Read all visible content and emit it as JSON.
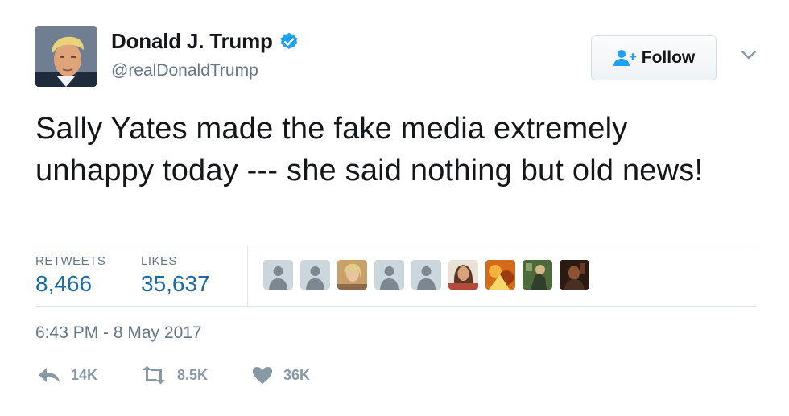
{
  "author": {
    "name": "Donald J. Trump",
    "handle": "@realDonaldTrump"
  },
  "follow_button": {
    "label": "Follow"
  },
  "tweet": {
    "text": "Sally Yates made the fake media extremely unhappy today --- she said nothing but old news!"
  },
  "stats": {
    "retweets_label": "RETWEETS",
    "retweets_value": "8,466",
    "likes_label": "LIKES",
    "likes_value": "35,637"
  },
  "timestamp": "6:43 PM - 8 May 2017",
  "actions": {
    "reply_count": "14K",
    "retweet_count": "8.5K",
    "like_count": "36K"
  },
  "colors": {
    "verified_blue": "#1da1f2",
    "link_blue": "#1b6aa5",
    "muted_gray": "#657786",
    "icon_gray": "#8899a6"
  }
}
